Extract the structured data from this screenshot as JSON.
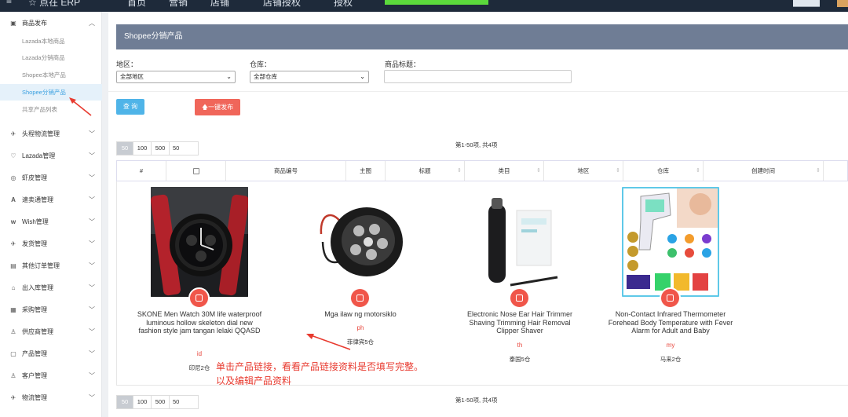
{
  "topbar": {
    "items": [
      "≡",
      "☆ 点在 ERP",
      "首页",
      "营销",
      "店铺",
      "店铺授权 ",
      "授权 "
    ],
    "promo_color": "#5bd93c",
    "user_name": "████"
  },
  "sidebar": {
    "group_product": {
      "label": "商品发布",
      "icon": "publish-icon",
      "expanded": true
    },
    "subitems": [
      "Lazada本地商品",
      "Lazada分销商品",
      "Shopee本地产品",
      "Shopee分销产品",
      "共享产品列表"
    ],
    "active_index": 3,
    "groups": [
      {
        "label": "头程物流管理",
        "icon": "plane-icon"
      },
      {
        "label": "Lazada管理",
        "icon": "handshake-icon"
      },
      {
        "label": "虾皮管理",
        "icon": "shrimp-icon"
      },
      {
        "label": "速卖通管理",
        "icon": "aliexpress-icon"
      },
      {
        "label": "Wish管理",
        "icon": "wish-icon"
      },
      {
        "label": "发货管理",
        "icon": "truck-icon"
      },
      {
        "label": "其他订单管理",
        "icon": "list-icon"
      },
      {
        "label": "出入库管理",
        "icon": "warehouse-icon"
      },
      {
        "label": "采购管理",
        "icon": "cart-icon"
      },
      {
        "label": "供应商管理",
        "icon": "supplier-icon"
      },
      {
        "label": "产品管理",
        "icon": "box-icon"
      },
      {
        "label": "客户管理",
        "icon": "customer-icon"
      },
      {
        "label": "物流管理",
        "icon": "logistics-icon"
      }
    ]
  },
  "page": {
    "title": "Shopee分销产品",
    "filters": {
      "region_label": "地区：",
      "region_value": "全部地区",
      "warehouse_label": "仓库：",
      "warehouse_value": "全部仓库",
      "title_label": "商品标题：",
      "title_value": ""
    },
    "query_label": "查 询",
    "publish_label": "一键发布",
    "page_sizes": [
      "50",
      "100",
      "500",
      "50"
    ],
    "page_info": "第1-50项, 共4项",
    "columns": [
      "#",
      "",
      "商品编号",
      "主图",
      "标题",
      "类目",
      "地区",
      "仓库",
      "创建时间"
    ]
  },
  "products": [
    {
      "title": "SKONE Men Watch 30M life waterproof luminous hollow skeleton dial new fashion style jam tangan lelaki QQASD",
      "country": "id",
      "warehouse": "印尼2仓"
    },
    {
      "title": "Mga ilaw ng motorsiklo",
      "country": "ph",
      "warehouse": "菲律宾5仓"
    },
    {
      "title": "Electronic Nose Ear Hair Trimmer Shaving Trimming Hair Removal Clipper Shaver",
      "country": "th",
      "warehouse": "泰国5仓"
    },
    {
      "title": "Non-Contact Infrared Thermometer Forehead Body Temperature with Fever Alarm for Adult and Baby",
      "country": "my",
      "warehouse": "马来2仓"
    }
  ],
  "annotation": {
    "line1": "单击产品链接，看看产品链接资料是否填写完整。",
    "line2": "以及编辑产品资料",
    "color": "#e83a2f"
  }
}
